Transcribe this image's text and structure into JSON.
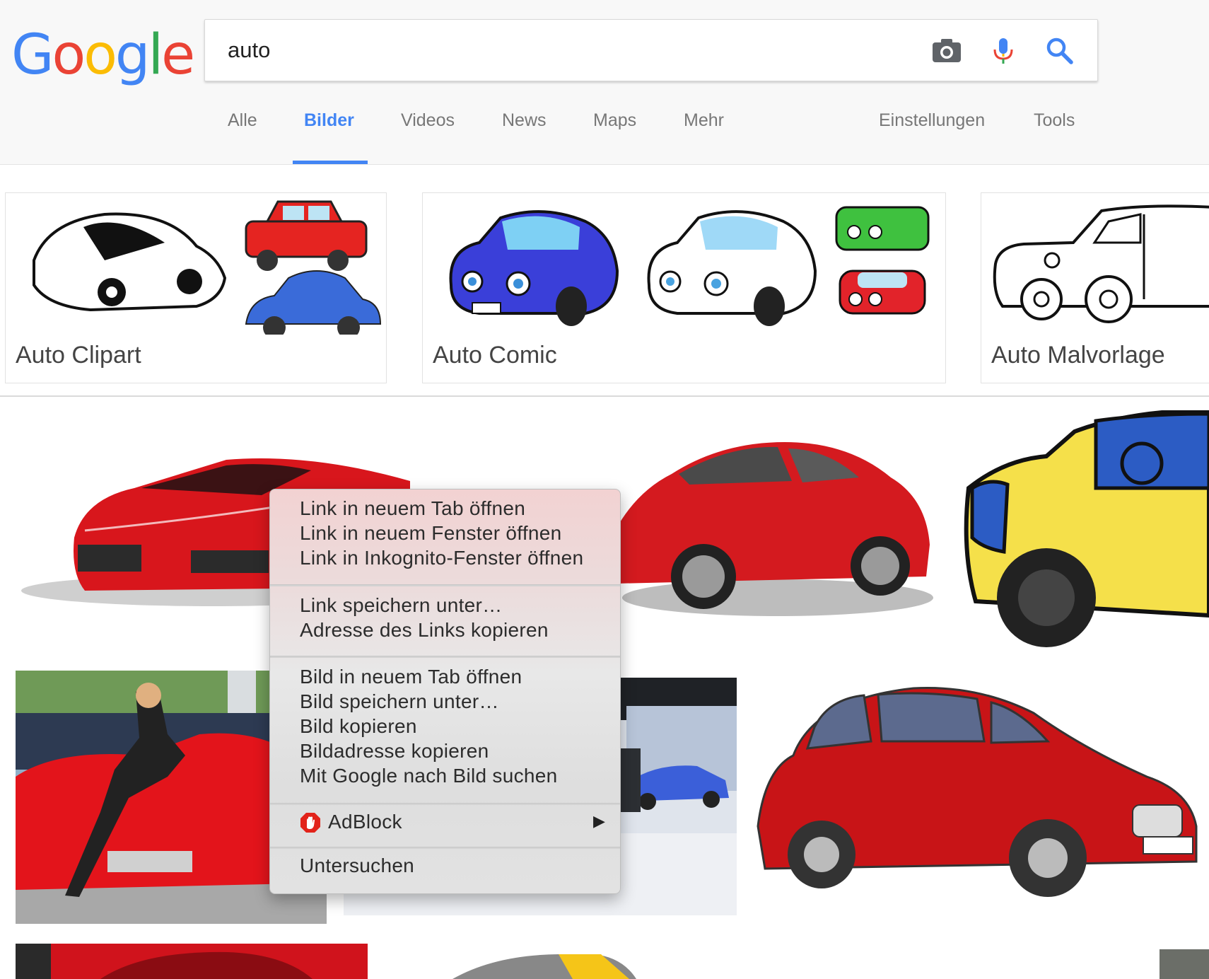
{
  "logo": {
    "letters": [
      "G",
      "o",
      "o",
      "g",
      "l",
      "e"
    ],
    "colors": [
      "#4285f4",
      "#ea4335",
      "#fbbc05",
      "#4285f4",
      "#34a853",
      "#ea4335"
    ]
  },
  "search": {
    "value": "auto",
    "icons": [
      "camera-icon",
      "microphone-icon",
      "search-icon"
    ]
  },
  "tabs": [
    "Alle",
    "Bilder",
    "Videos",
    "News",
    "Maps",
    "Mehr"
  ],
  "tools": {
    "settings": "Einstellungen",
    "tools": "Tools"
  },
  "related": [
    {
      "label": "Auto Clipart"
    },
    {
      "label": "Auto Comic"
    },
    {
      "label": "Auto Malvorlage"
    }
  ],
  "context_menu": {
    "groups": [
      [
        "Link in neuem Tab öffnen",
        "Link in neuem Fenster öffnen",
        "Link in Inkognito-Fenster öffnen"
      ],
      [
        "Link speichern unter…",
        "Adresse des Links kopieren"
      ],
      [
        "Bild in neuem Tab öffnen",
        "Bild speichern unter…",
        "Bild kopieren",
        "Bildadresse kopieren",
        "Mit Google nach Bild suchen"
      ],
      [
        "AdBlock"
      ],
      [
        "Untersuchen"
      ]
    ],
    "submenu_arrow": "▶"
  },
  "colors": {
    "accent": "#4285f4",
    "car_red": "#d8161c",
    "adblock_red": "#e2231a"
  }
}
